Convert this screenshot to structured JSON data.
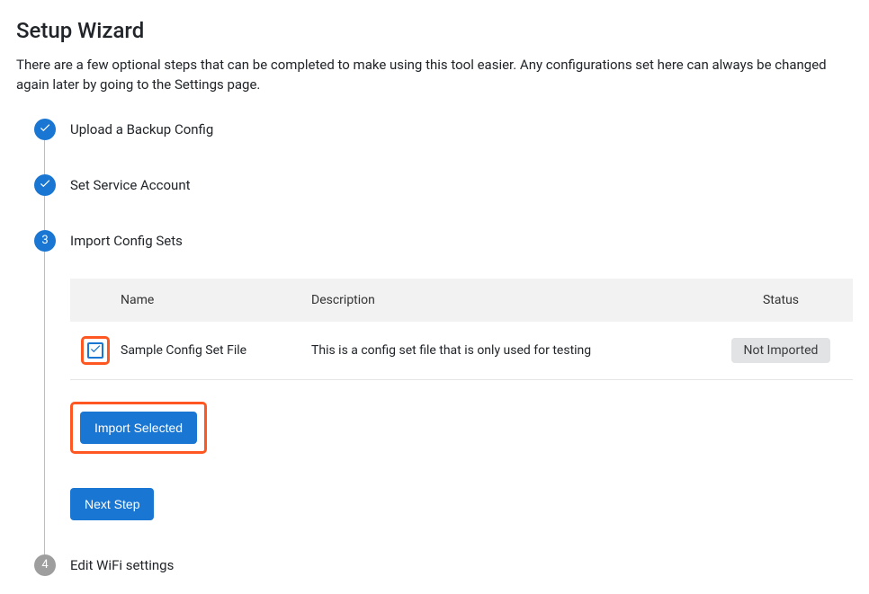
{
  "pageTitle": "Setup Wizard",
  "intro": "There are a few optional steps that can be completed to make using this tool easier. Any configurations set here can always be changed again later by going to the Settings page.",
  "steps": [
    {
      "label": "Upload a Backup Config",
      "state": "done"
    },
    {
      "label": "Set Service Account",
      "state": "done"
    },
    {
      "label": "Import Config Sets",
      "state": "active",
      "number": "3"
    },
    {
      "label": "Edit WiFi settings",
      "state": "future",
      "number": "4"
    }
  ],
  "table": {
    "headers": {
      "name": "Name",
      "description": "Description",
      "status": "Status"
    },
    "row": {
      "name": "Sample Config Set File",
      "description": "This is a config set file that is only used for testing",
      "status": "Not Imported"
    }
  },
  "buttons": {
    "importSelected": "Import Selected",
    "nextStep": "Next Step"
  }
}
